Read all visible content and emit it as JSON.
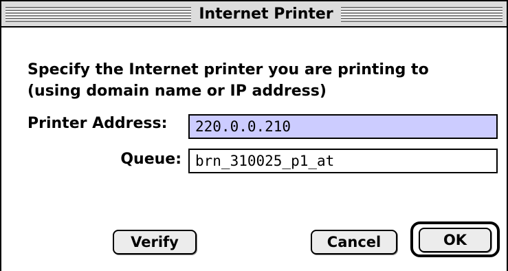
{
  "window": {
    "title": "Internet Printer"
  },
  "dialog": {
    "prompt_line1": "Specify the Internet printer you are printing to",
    "prompt_line2": "(using domain name or IP address)",
    "address_label": "Printer Address:",
    "address_value": "220.0.0.210",
    "queue_label": "Queue:",
    "queue_value": "brn_310025_p1_at"
  },
  "buttons": {
    "verify": "Verify",
    "cancel": "Cancel",
    "ok": "OK"
  },
  "colors": {
    "selected_field_bg": "#ccccff",
    "titlebar_bg": "#dcdcdc",
    "button_bg": "#ececec"
  }
}
